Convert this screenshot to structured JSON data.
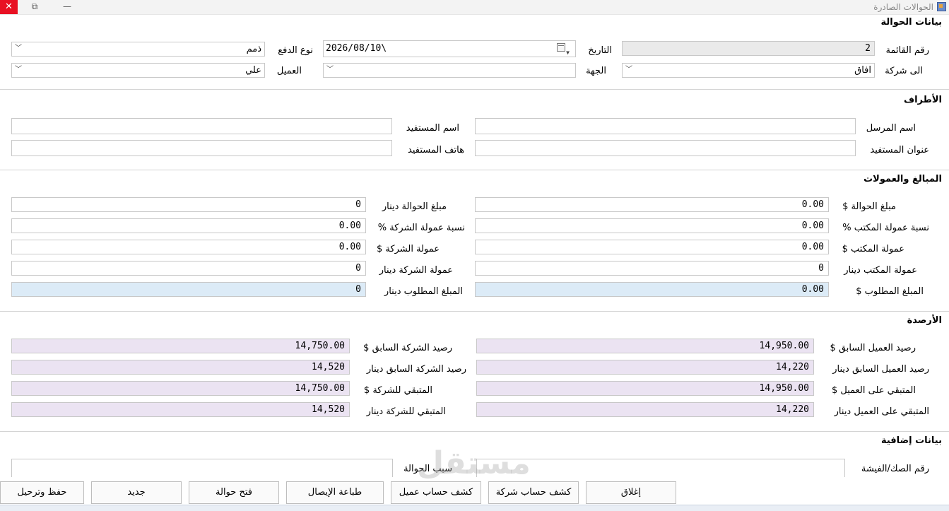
{
  "window": {
    "title": "الحوالات الصادرة",
    "close_glyph": "✕",
    "restore_glyph": "⧉",
    "minimize_glyph": "—"
  },
  "sections": {
    "transfer": "بيانات الحوالة",
    "parties": "الأطراف",
    "amounts": "المبالغ والعمولات",
    "balances": "الأرصدة",
    "extra": "بيانات إضافية"
  },
  "transfer": {
    "list_no_label": "رقم القائمة",
    "list_no": "2",
    "date_label": "التاريخ",
    "date": "2026/08/10\\",
    "payment_type_label": "نوع الدفع",
    "payment_type": "ذمم",
    "to_company_label": "الى شركة",
    "to_company": "افاق",
    "destination_label": "الجهة",
    "destination": "",
    "customer_label": "العميل",
    "customer": "علي"
  },
  "parties": {
    "sender_label": "اسم المرسل",
    "sender": "",
    "beneficiary_label": "اسم المستفيد",
    "beneficiary": "",
    "beneficiary_address_label": "عنوان المستفيد",
    "beneficiary_address": "",
    "beneficiary_phone_label": "هاتف المستفيد",
    "beneficiary_phone": ""
  },
  "amounts": {
    "amount_usd_label": "مبلغ الحوالة $",
    "amount_usd": "0.00",
    "amount_iqd_label": "مبلغ الحوالة دينار",
    "amount_iqd": "0",
    "office_pct_label": "نسبة عمولة المكتب %",
    "office_pct": "0.00",
    "company_pct_label": "نسبة عمولة الشركة %",
    "company_pct": "0.00",
    "office_comm_usd_label": "عمولة المكتب $",
    "office_comm_usd": "0.00",
    "company_comm_usd_label": "عمولة الشركة $",
    "company_comm_usd": "0.00",
    "office_comm_iqd_label": "عمولة المكتب دينار",
    "office_comm_iqd": "0",
    "company_comm_iqd_label": "عمولة الشركة دينار",
    "company_comm_iqd": "0",
    "required_usd_label": "المبلغ المطلوب $",
    "required_usd": "0.00",
    "required_iqd_label": "المبلغ المطلوب دينار",
    "required_iqd": "0"
  },
  "balances": {
    "cust_prev_usd_label": "رصيد العميل السابق $",
    "cust_prev_usd": "14,950.00",
    "comp_prev_usd_label": "رصيد الشركة السابق $",
    "comp_prev_usd": "14,750.00",
    "cust_prev_iqd_label": "رصيد العميل السابق دينار",
    "cust_prev_iqd": "14,220",
    "comp_prev_iqd_label": "رصيد الشركة السابق دينار",
    "comp_prev_iqd": "14,520",
    "cust_rem_usd_label": "المتبقي على العميل $",
    "cust_rem_usd": "14,950.00",
    "comp_rem_usd_label": "المتبقي للشركة $",
    "comp_rem_usd": "14,750.00",
    "cust_rem_iqd_label": "المتبقي على العميل دينار",
    "cust_rem_iqd": "14,220",
    "comp_rem_iqd_label": "المتبقي للشركة دينار",
    "comp_rem_iqd": "14,520"
  },
  "extra": {
    "voucher_label": "رقم الصك/الفيشة",
    "voucher": "",
    "reason_label": "سبب الحوالة",
    "reason": ""
  },
  "buttons": {
    "close": "إغلاق",
    "company_statement": "كشف حساب شركة",
    "customer_statement": "كشف حساب عميل",
    "print_receipt": "طباعة الإيصال",
    "open_transfer": "فتح حوالة",
    "new": "جديد",
    "save_post": "حفظ وترحيل"
  },
  "watermark": "مستقل"
}
